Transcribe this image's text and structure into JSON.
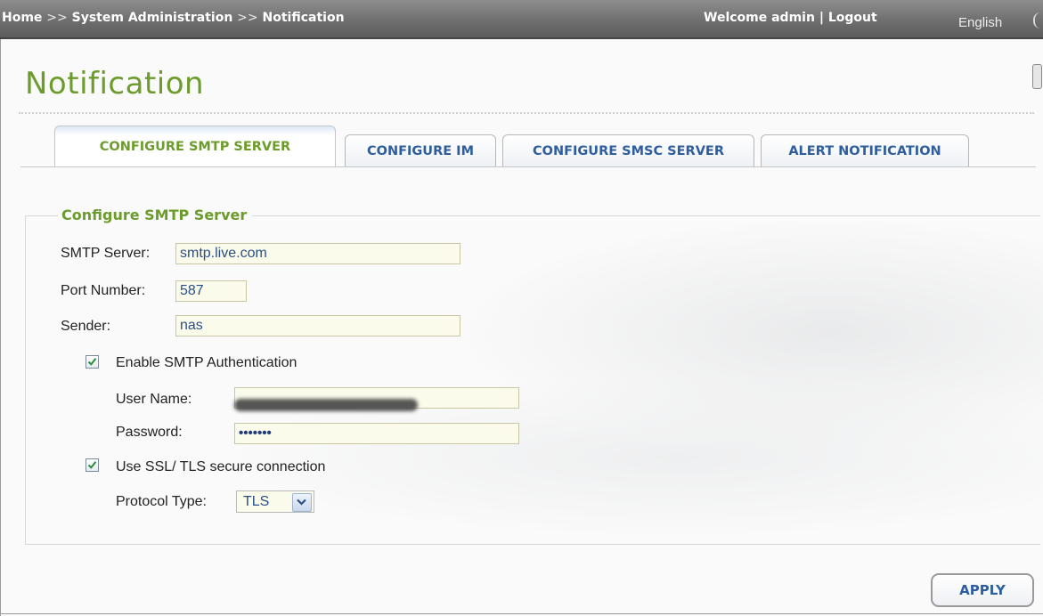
{
  "topbar": {
    "breadcrumb": [
      "Home",
      "System Administration",
      "Notification"
    ],
    "breadcrumb_sep": ">>",
    "welcome": "Welcome admin",
    "divider": "|",
    "logout": "Logout",
    "language": "English"
  },
  "page": {
    "title": "Notification"
  },
  "tabs": [
    {
      "label": "CONFIGURE SMTP SERVER",
      "active": true
    },
    {
      "label": "CONFIGURE IM",
      "active": false
    },
    {
      "label": "CONFIGURE SMSC SERVER",
      "active": false
    },
    {
      "label": "ALERT NOTIFICATION",
      "active": false
    }
  ],
  "smtp": {
    "legend": "Configure SMTP Server",
    "server_label": "SMTP Server:",
    "server_value": "smtp.live.com",
    "port_label": "Port Number:",
    "port_value": "587",
    "sender_label": "Sender:",
    "sender_value": "nas",
    "auth_label": "Enable SMTP Authentication",
    "auth_checked": true,
    "username_label": "User Name:",
    "password_label": "Password:",
    "password_value": "•••••••",
    "ssl_label": "Use SSL/ TLS secure connection",
    "ssl_checked": true,
    "protocol_label": "Protocol Type:",
    "protocol_value": "TLS"
  },
  "actions": {
    "apply_label": "APPLY"
  },
  "colors": {
    "accent_green": "#6c9c2b",
    "link_blue": "#2e5e9e",
    "topbar_gray": "#6f6f6f",
    "input_bg": "#fbfbeb"
  }
}
